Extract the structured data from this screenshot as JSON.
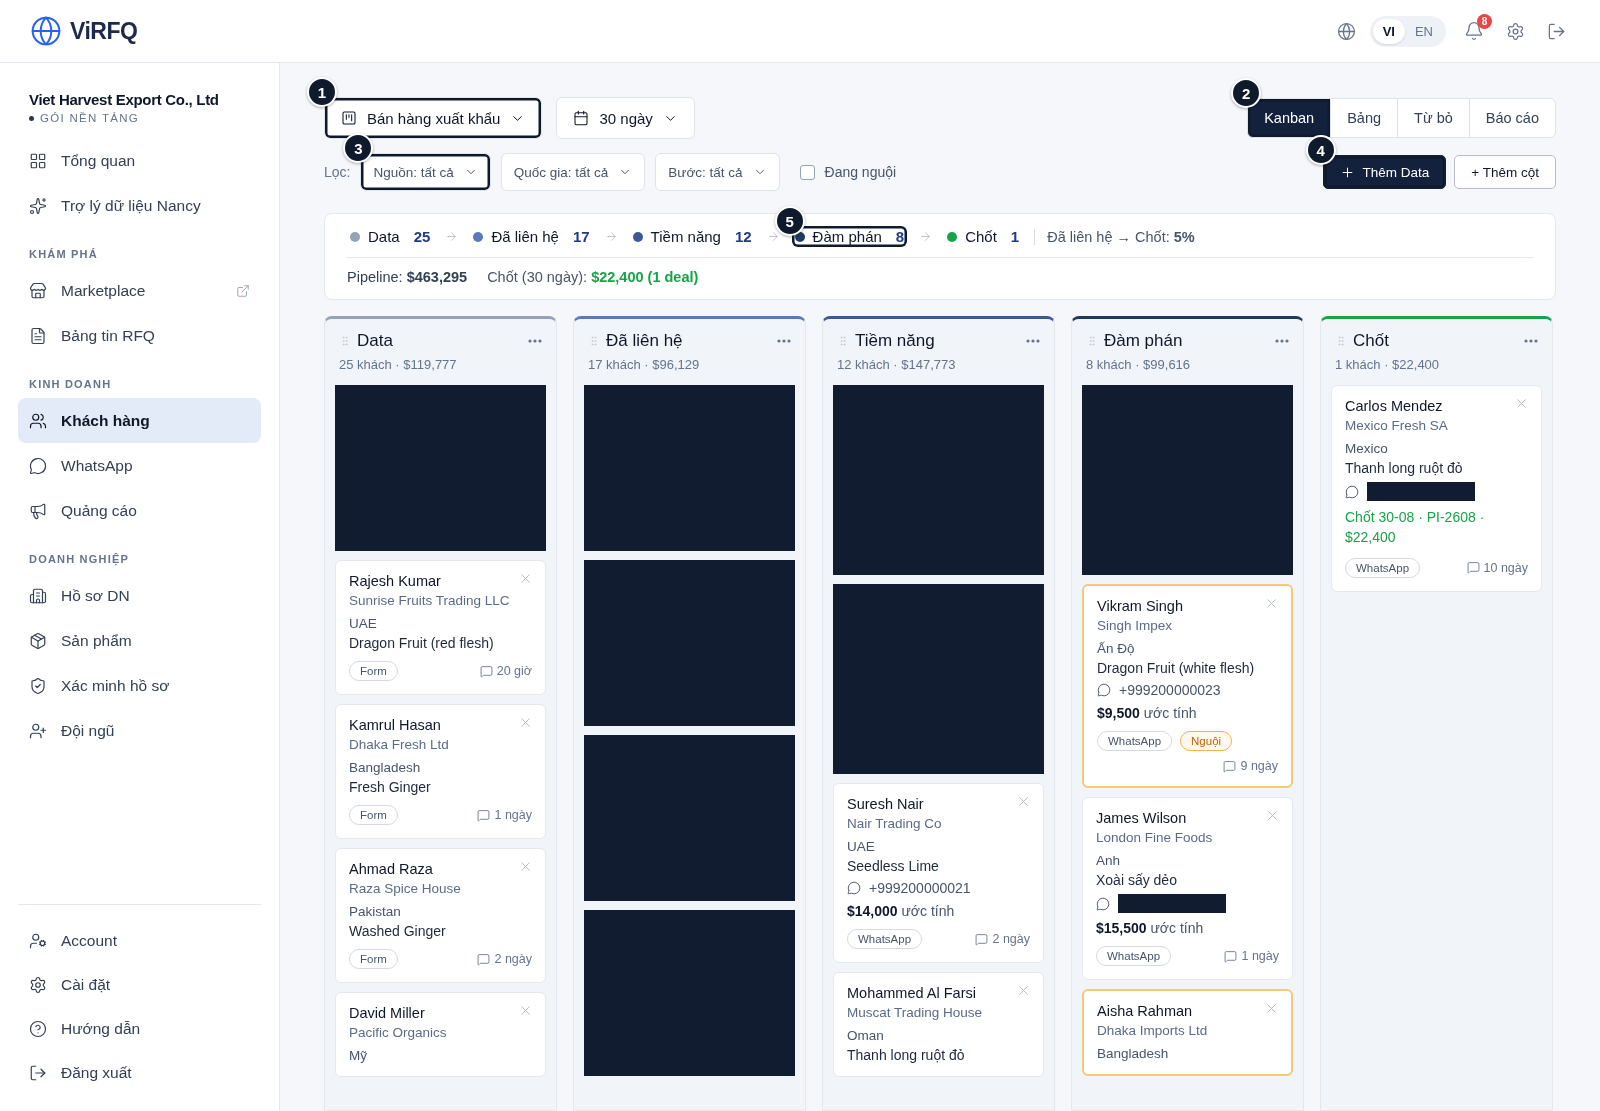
{
  "header": {
    "logo": "ViRFQ",
    "languages": [
      {
        "label": "VI",
        "selected": true
      },
      {
        "label": "EN",
        "selected": false
      }
    ],
    "notifications": "8"
  },
  "sidebar": {
    "company": "Viet Harvest Export Co., Ltd",
    "plan": "GÓI NỀN TẢNG",
    "sections": [
      {
        "items": [
          {
            "label": "Tổng quan",
            "selected": false
          },
          {
            "label": "Trợ lý dữ liệu Nancy",
            "selected": false
          }
        ]
      },
      {
        "title": "KHÁM PHÁ",
        "items": [
          {
            "label": "Marketplace",
            "selected": false,
            "external": true
          },
          {
            "label": "Bảng tin RFQ",
            "selected": false
          }
        ]
      },
      {
        "title": "KINH DOANH",
        "items": [
          {
            "label": "Khách hàng",
            "selected": true
          },
          {
            "label": "WhatsApp",
            "selected": false
          },
          {
            "label": "Quảng cáo",
            "selected": false
          }
        ]
      },
      {
        "title": "DOANH NGHIỆP",
        "items": [
          {
            "label": "Hồ sơ DN",
            "selected": false
          },
          {
            "label": "Sản phẩm",
            "selected": false
          },
          {
            "label": "Xác minh hồ sơ",
            "selected": false
          },
          {
            "label": "Đội ngũ",
            "selected": false
          }
        ]
      }
    ],
    "footer": [
      {
        "label": "Account"
      },
      {
        "label": "Cài đặt"
      },
      {
        "label": "Hướng dẫn"
      },
      {
        "label": "Đăng xuất"
      }
    ]
  },
  "toolbar": {
    "pipeline": {
      "label": "Bán hàng xuất khẩu",
      "step": "1"
    },
    "period": {
      "label": "30 ngày"
    },
    "views": [
      {
        "label": "Kanban",
        "selected": true,
        "step": "2"
      },
      {
        "label": "Bảng",
        "selected": false
      },
      {
        "label": "Từ bỏ",
        "selected": false
      },
      {
        "label": "Báo cáo",
        "selected": false
      }
    ]
  },
  "filters": {
    "label": "Lọc:",
    "dropdowns": [
      {
        "label": "Nguồn: tất cả",
        "step": "3"
      },
      {
        "label": "Quốc gia: tất cả"
      },
      {
        "label": "Bước: tất cả"
      }
    ],
    "cold_only": {
      "label": "Đang nguội",
      "checked": false
    },
    "buttons": [
      {
        "label": "Thêm Data",
        "kind": "primary",
        "step": "4"
      },
      {
        "label": "+ Thêm cột",
        "kind": "secondary"
      }
    ]
  },
  "funnel": {
    "stages": [
      {
        "label": "Data",
        "count": "25",
        "color": "#94a3b8"
      },
      {
        "label": "Đã liên hệ",
        "count": "17",
        "color": "#5b7bb8"
      },
      {
        "label": "Tiềm năng",
        "count": "12",
        "color": "#3b5a94"
      },
      {
        "label": "Đàm phán",
        "count": "8",
        "color": "#1e3a5f",
        "step": "5"
      },
      {
        "label": "Chốt",
        "count": "1",
        "color": "#16a34a"
      }
    ],
    "conversion": "Đã liên hệ → Chốt: **5%**",
    "pipeline": "Pipeline: **$463,295**",
    "closed_label": "Chốt (30 ngày): ",
    "closed_value": "$22,400 (1 deal)"
  },
  "board": [
    {
      "title": "Data",
      "summary": "25 khách · $119,777",
      "color": "#94a3b8",
      "cards": [
        {
          "kind": "redacted"
        },
        {
          "kind": "lead",
          "name": "Rajesh Kumar",
          "company": "Sunrise Fruits Trading LLC",
          "country": "UAE",
          "product": "Dragon Fruit (red flesh)",
          "tags": [
            {
              "label": "Form",
              "kind": "plain"
            }
          ],
          "time": "20 giờ",
          "cold": false
        },
        {
          "kind": "lead",
          "name": "Kamrul Hasan",
          "company": "Dhaka Fresh Ltd",
          "country": "Bangladesh",
          "product": "Fresh Ginger",
          "tags": [
            {
              "label": "Form",
              "kind": "plain"
            }
          ],
          "time": "1 ngày",
          "cold": false
        },
        {
          "kind": "lead",
          "name": "Ahmad Raza",
          "company": "Raza Spice House",
          "country": "Pakistan",
          "product": "Washed Ginger",
          "tags": [
            {
              "label": "Form",
              "kind": "plain"
            }
          ],
          "time": "2 ngày",
          "cold": false
        },
        {
          "kind": "lead",
          "name": "David Miller",
          "company": "Pacific Organics",
          "country": "Mỹ",
          "cold": false
        }
      ]
    },
    {
      "title": "Đã liên hệ",
      "summary": "17 khách · $96,129",
      "color": "#5b7bb8",
      "cards": [
        {
          "kind": "redacted"
        },
        {
          "kind": "redacted"
        },
        {
          "kind": "redacted"
        },
        {
          "kind": "redacted"
        }
      ]
    },
    {
      "title": "Tiềm năng",
      "summary": "12 khách · $147,773",
      "color": "#3b5a94",
      "cards": [
        {
          "kind": "redacted_tall"
        },
        {
          "kind": "redacted_tall"
        },
        {
          "kind": "lead",
          "name": "Suresh Nair",
          "company": "Nair Trading Co",
          "country": "UAE",
          "product": "Seedless Lime",
          "contact": {
            "kind": "phone",
            "text": "+999200000021"
          },
          "value": "$14,000",
          "value_note": "ước tính",
          "tags": [
            {
              "label": "WhatsApp",
              "kind": "plain"
            }
          ],
          "time": "2 ngày",
          "cold": false
        },
        {
          "kind": "lead",
          "name": "Mohammed Al Farsi",
          "company": "Muscat Trading House",
          "country": "Oman",
          "product": "Thanh long ruột đỏ",
          "cold": false
        }
      ]
    },
    {
      "title": "Đàm phán",
      "summary": "8 khách · $99,616",
      "color": "#1e3a5f",
      "cards": [
        {
          "kind": "redacted_tall"
        },
        {
          "kind": "lead",
          "name": "Vikram Singh",
          "company": "Singh Impex",
          "country": "Ấn Độ",
          "product": "Dragon Fruit (white flesh)",
          "contact": {
            "kind": "phone",
            "text": "+999200000023"
          },
          "value": "$9,500",
          "value_note": "ước tính",
          "tags": [
            {
              "label": "WhatsApp",
              "kind": "plain"
            },
            {
              "label": "Nguội",
              "kind": "warning"
            }
          ],
          "time": "9 ngày",
          "cold": true
        },
        {
          "kind": "lead",
          "name": "James Wilson",
          "company": "London Fine Foods",
          "country": "Anh",
          "product": "Xoài sấy dẻo",
          "contact": {
            "kind": "redacted"
          },
          "value": "$15,500",
          "value_note": "ước tính",
          "tags": [
            {
              "label": "WhatsApp",
              "kind": "plain"
            }
          ],
          "time": "1 ngày",
          "cold": false
        },
        {
          "kind": "lead",
          "name": "Aisha Rahman",
          "company": "Dhaka Imports Ltd",
          "country": "Bangladesh",
          "cold": true
        }
      ]
    },
    {
      "title": "Chốt",
      "summary": "1 khách · $22,400",
      "color": "#16a34a",
      "cards": [
        {
          "kind": "lead",
          "name": "Carlos Mendez",
          "company": "Mexico Fresh SA",
          "country": "Mexico",
          "product": "Thanh long ruột đỏ",
          "contact": {
            "kind": "redacted"
          },
          "closed": "Chốt 30-08 · PI-2608 · $22,400",
          "tags": [
            {
              "label": "WhatsApp",
              "kind": "plain"
            }
          ],
          "time": "10 ngày",
          "cold": false
        }
      ]
    }
  ]
}
